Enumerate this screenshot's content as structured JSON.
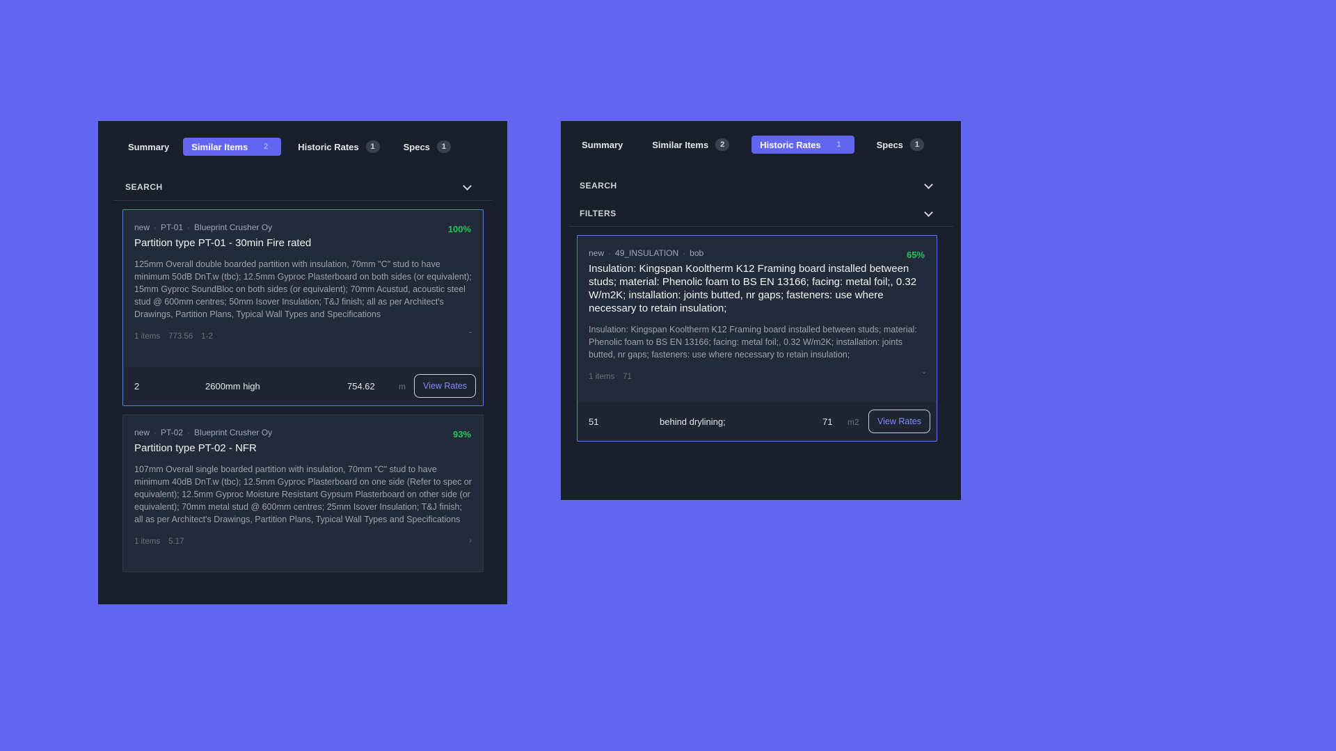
{
  "left_panel": {
    "tabs": [
      {
        "label": "Summary",
        "count": ""
      },
      {
        "label": "Similar Items",
        "count": "2"
      },
      {
        "label": "Historic Rates",
        "count": "1"
      },
      {
        "label": "Specs",
        "count": "1"
      }
    ],
    "active_tab": "Similar Items",
    "search_label": "SEARCH",
    "cards": [
      {
        "status": "new",
        "code": "PT-01",
        "supplier": "Blueprint Crusher Oy",
        "match": "100%",
        "title": "Partition type PT-01 - 30min Fire rated",
        "description": "125mm Overall double boarded partition with insulation, 70mm \"C\" stud to have minimum 50dB DnT.w (tbc); 12.5mm Gyproc Plasterboard on both sides (or equivalent); 15mm Gyproc SoundBloc on both sides (or equivalent); 70mm Acustud, acoustic steel stud @ 600mm centres; 50mm Isover Insulation; T&J finish; all as per Architect's Drawings, Partition Plans, Typical Wall Types and Specifications",
        "items": "1 items",
        "amount": "773.56",
        "range": "1-2",
        "rate": {
          "qty": "2",
          "desc": "2600mm high",
          "value": "754.62",
          "unit": "m",
          "button": "View Rates"
        }
      },
      {
        "status": "new",
        "code": "PT-02",
        "supplier": "Blueprint Crusher Oy",
        "match": "93%",
        "title": "Partition type PT-02 - NFR",
        "description": "107mm Overall single boarded partition with insulation, 70mm \"C\" stud to have minimum 40dB DnT.w (tbc); 12.5mm Gyproc Plasterboard on one side (Refer to spec or equivalent); 12.5mm Gyproc Moisture Resistant Gypsum Plasterboard on other side (or equivalent); 70mm metal stud @ 600mm centres; 25mm Isover Insulation; T&J finish; all as per Architect's Drawings, Partition Plans, Typical Wall Types and Specifications",
        "items": "1 items",
        "amount": "5.17"
      }
    ]
  },
  "right_panel": {
    "tabs": [
      {
        "label": "Summary",
        "count": ""
      },
      {
        "label": "Similar Items",
        "count": "2"
      },
      {
        "label": "Historic Rates",
        "count": "1"
      },
      {
        "label": "Specs",
        "count": "1"
      }
    ],
    "active_tab": "Historic Rates",
    "search_label": "SEARCH",
    "filters_label": "FILTERS",
    "card": {
      "status": "new",
      "code": "49_INSULATION",
      "supplier": "bob",
      "match": "65%",
      "title": "Insulation: Kingspan Kooltherm K12 Framing board installed between studs; material: Phenolic foam to BS EN 13166; facing: metal foil;, 0.32 W/m2K; installation: joints butted, nr gaps; fasteners: use where necessary to retain insulation;",
      "description": "Insulation: Kingspan Kooltherm K12 Framing board installed between studs; material: Phenolic foam to BS EN 13166; facing: metal foil;, 0.32 W/m2K; installation: joints butted, nr gaps; fasteners: use where necessary to retain insulation;",
      "items": "1 items",
      "amount": "71",
      "rate": {
        "qty": "51",
        "desc": "behind drylining;",
        "value": "71",
        "unit": "m2",
        "button": "View Rates"
      }
    }
  },
  "colors": {
    "background": "#6366f1",
    "panel": "#1a1f2c",
    "card": "#232b3b",
    "accent": "#6366f1",
    "match_green": "#22c55e",
    "selected_border": "#4f86e6"
  }
}
